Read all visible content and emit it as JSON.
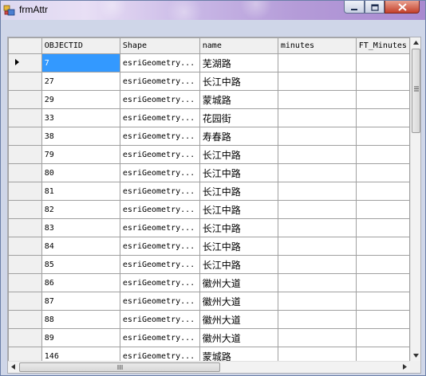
{
  "window": {
    "title": "frmAttr"
  },
  "grid": {
    "columns": [
      "OBJECTID",
      "Shape",
      "name",
      "minutes",
      "FT_Minutes"
    ],
    "rows": [
      {
        "OBJECTID": "7",
        "Shape": "esriGeometry...",
        "name": "芜湖路"
      },
      {
        "OBJECTID": "27",
        "Shape": "esriGeometry...",
        "name": "长江中路"
      },
      {
        "OBJECTID": "29",
        "Shape": "esriGeometry...",
        "name": "蒙城路"
      },
      {
        "OBJECTID": "33",
        "Shape": "esriGeometry...",
        "name": "花园街"
      },
      {
        "OBJECTID": "38",
        "Shape": "esriGeometry...",
        "name": "寿春路"
      },
      {
        "OBJECTID": "79",
        "Shape": "esriGeometry...",
        "name": "长江中路"
      },
      {
        "OBJECTID": "80",
        "Shape": "esriGeometry...",
        "name": "长江中路"
      },
      {
        "OBJECTID": "81",
        "Shape": "esriGeometry...",
        "name": "长江中路"
      },
      {
        "OBJECTID": "82",
        "Shape": "esriGeometry...",
        "name": "长江中路"
      },
      {
        "OBJECTID": "83",
        "Shape": "esriGeometry...",
        "name": "长江中路"
      },
      {
        "OBJECTID": "84",
        "Shape": "esriGeometry...",
        "name": "长江中路"
      },
      {
        "OBJECTID": "85",
        "Shape": "esriGeometry...",
        "name": "长江中路"
      },
      {
        "OBJECTID": "86",
        "Shape": "esriGeometry...",
        "name": "徽州大道"
      },
      {
        "OBJECTID": "87",
        "Shape": "esriGeometry...",
        "name": "徽州大道"
      },
      {
        "OBJECTID": "88",
        "Shape": "esriGeometry...",
        "name": "徽州大道"
      },
      {
        "OBJECTID": "89",
        "Shape": "esriGeometry...",
        "name": "徽州大道"
      },
      {
        "OBJECTID": "146",
        "Shape": "esriGeometry...",
        "name": "蒙城路"
      }
    ],
    "selected_row": 0,
    "selected_column": "OBJECTID"
  },
  "icons": {
    "row_indicator": "current-row-arrow-icon",
    "minimize": "minimize-icon",
    "maximize": "maximize-icon",
    "close": "close-icon"
  }
}
